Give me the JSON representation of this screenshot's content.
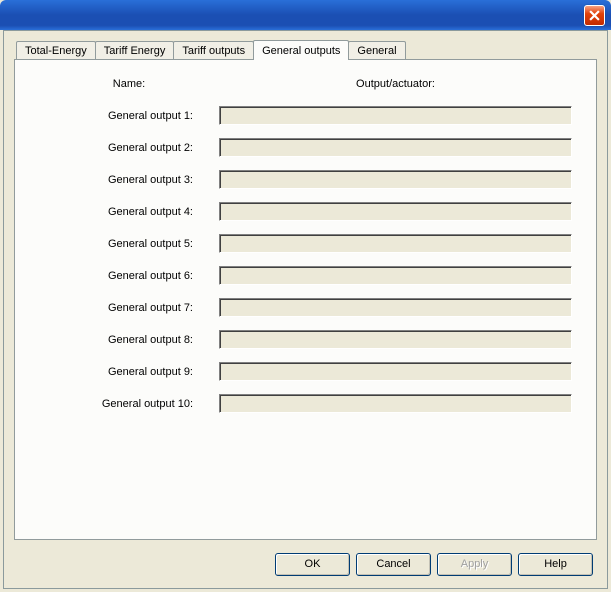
{
  "tabs": [
    {
      "label": "Total-Energy"
    },
    {
      "label": "Tariff Energy"
    },
    {
      "label": "Tariff outputs"
    },
    {
      "label": "General outputs"
    },
    {
      "label": "General"
    }
  ],
  "active_tab_index": 3,
  "headers": {
    "name": "Name:",
    "output": "Output/actuator:"
  },
  "rows": [
    {
      "label": "General output 1:",
      "value": ""
    },
    {
      "label": "General output 2:",
      "value": ""
    },
    {
      "label": "General output 3:",
      "value": ""
    },
    {
      "label": "General output 4:",
      "value": ""
    },
    {
      "label": "General output 5:",
      "value": ""
    },
    {
      "label": "General output 6:",
      "value": ""
    },
    {
      "label": "General output 7:",
      "value": ""
    },
    {
      "label": "General output 8:",
      "value": ""
    },
    {
      "label": "General output 9:",
      "value": ""
    },
    {
      "label": "General output 10:",
      "value": ""
    }
  ],
  "buttons": {
    "ok": "OK",
    "cancel": "Cancel",
    "apply": "Apply",
    "help": "Help"
  }
}
